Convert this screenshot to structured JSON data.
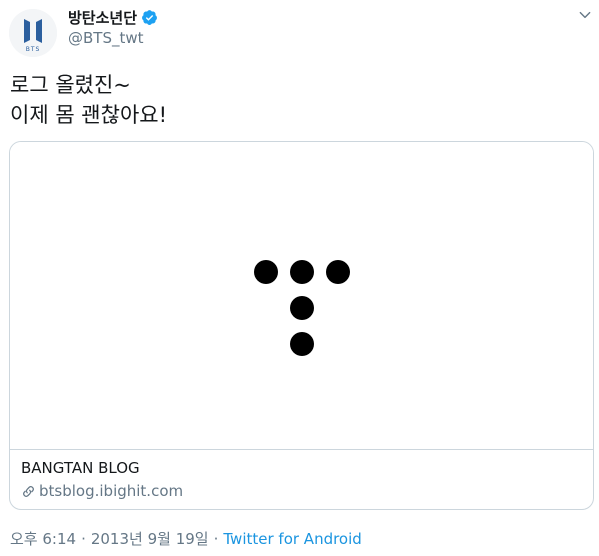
{
  "author": {
    "display_name": "방탄소년단",
    "handle": "@BTS_twt",
    "verified": true,
    "avatar_text": "BTS"
  },
  "tweet": {
    "lines": [
      "로그 올렸진~",
      "이제 몸 괜찮아요!"
    ]
  },
  "card": {
    "title": "BANGTAN BLOG",
    "url": "btsblog.ibighit.com",
    "image": "bangtan-dots-logo"
  },
  "meta": {
    "time": "오후 6:14",
    "separator": "·",
    "date": "2013년 9월 19일",
    "source": "Twitter for Android"
  },
  "icons": {
    "verified": "verified-badge-icon",
    "menu": "chevron-down-icon",
    "link": "link-icon"
  },
  "colors": {
    "accent": "#1da1f2",
    "link": "#1b95e0",
    "secondary_text": "#657786",
    "border": "#ccd6dd",
    "logo_blue": "#2b5f9e"
  }
}
